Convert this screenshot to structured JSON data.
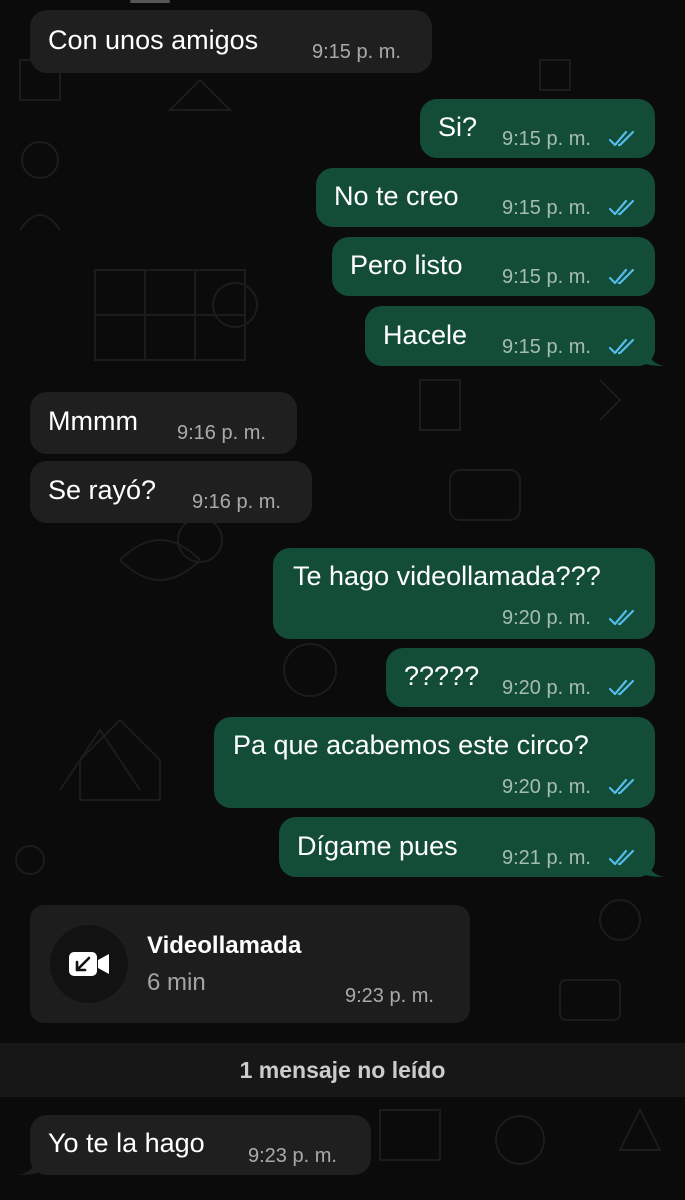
{
  "messages": [
    {
      "id": "m1",
      "direction": "in",
      "text": "Con unos amigos",
      "time": "9:15 p. m."
    },
    {
      "id": "m2",
      "direction": "out",
      "text": "Si?",
      "time": "9:15 p. m.",
      "read": true
    },
    {
      "id": "m3",
      "direction": "out",
      "text": "No te creo",
      "time": "9:15 p. m.",
      "read": true
    },
    {
      "id": "m4",
      "direction": "out",
      "text": "Pero listo",
      "time": "9:15 p. m.",
      "read": true
    },
    {
      "id": "m5",
      "direction": "out",
      "text": "Hacele",
      "time": "9:15 p. m.",
      "read": true
    },
    {
      "id": "m6",
      "direction": "in",
      "text": "Mmmm",
      "time": "9:16 p. m."
    },
    {
      "id": "m7",
      "direction": "in",
      "text": "Se rayó?",
      "time": "9:16 p. m."
    },
    {
      "id": "m8",
      "direction": "out",
      "text": "Te hago videollamada???",
      "time": "9:20 p. m.",
      "read": true
    },
    {
      "id": "m9",
      "direction": "out",
      "text": "?????",
      "time": "9:20 p. m.",
      "read": true
    },
    {
      "id": "m10",
      "direction": "out",
      "text": "Pa que acabemos este circo?",
      "time": "9:20 p. m.",
      "read": true
    },
    {
      "id": "m11",
      "direction": "out",
      "text": "Dígame pues",
      "time": "9:21 p. m.",
      "read": true
    },
    {
      "id": "m12",
      "direction": "in",
      "text": "Yo te la hago",
      "time": "9:23 p. m."
    }
  ],
  "video_call": {
    "title": "Videollamada",
    "duration": "6 min",
    "time": "9:23 p. m.",
    "icon": "incoming-video-call-icon"
  },
  "unread_divider": {
    "label": "1 mensaje no leído"
  },
  "colors": {
    "background": "#0b0b0b",
    "incoming_bubble": "#1f1f1f",
    "outgoing_bubble": "#134d37",
    "read_ticks": "#53bdeb",
    "meta_text": "#9a9a9a"
  }
}
